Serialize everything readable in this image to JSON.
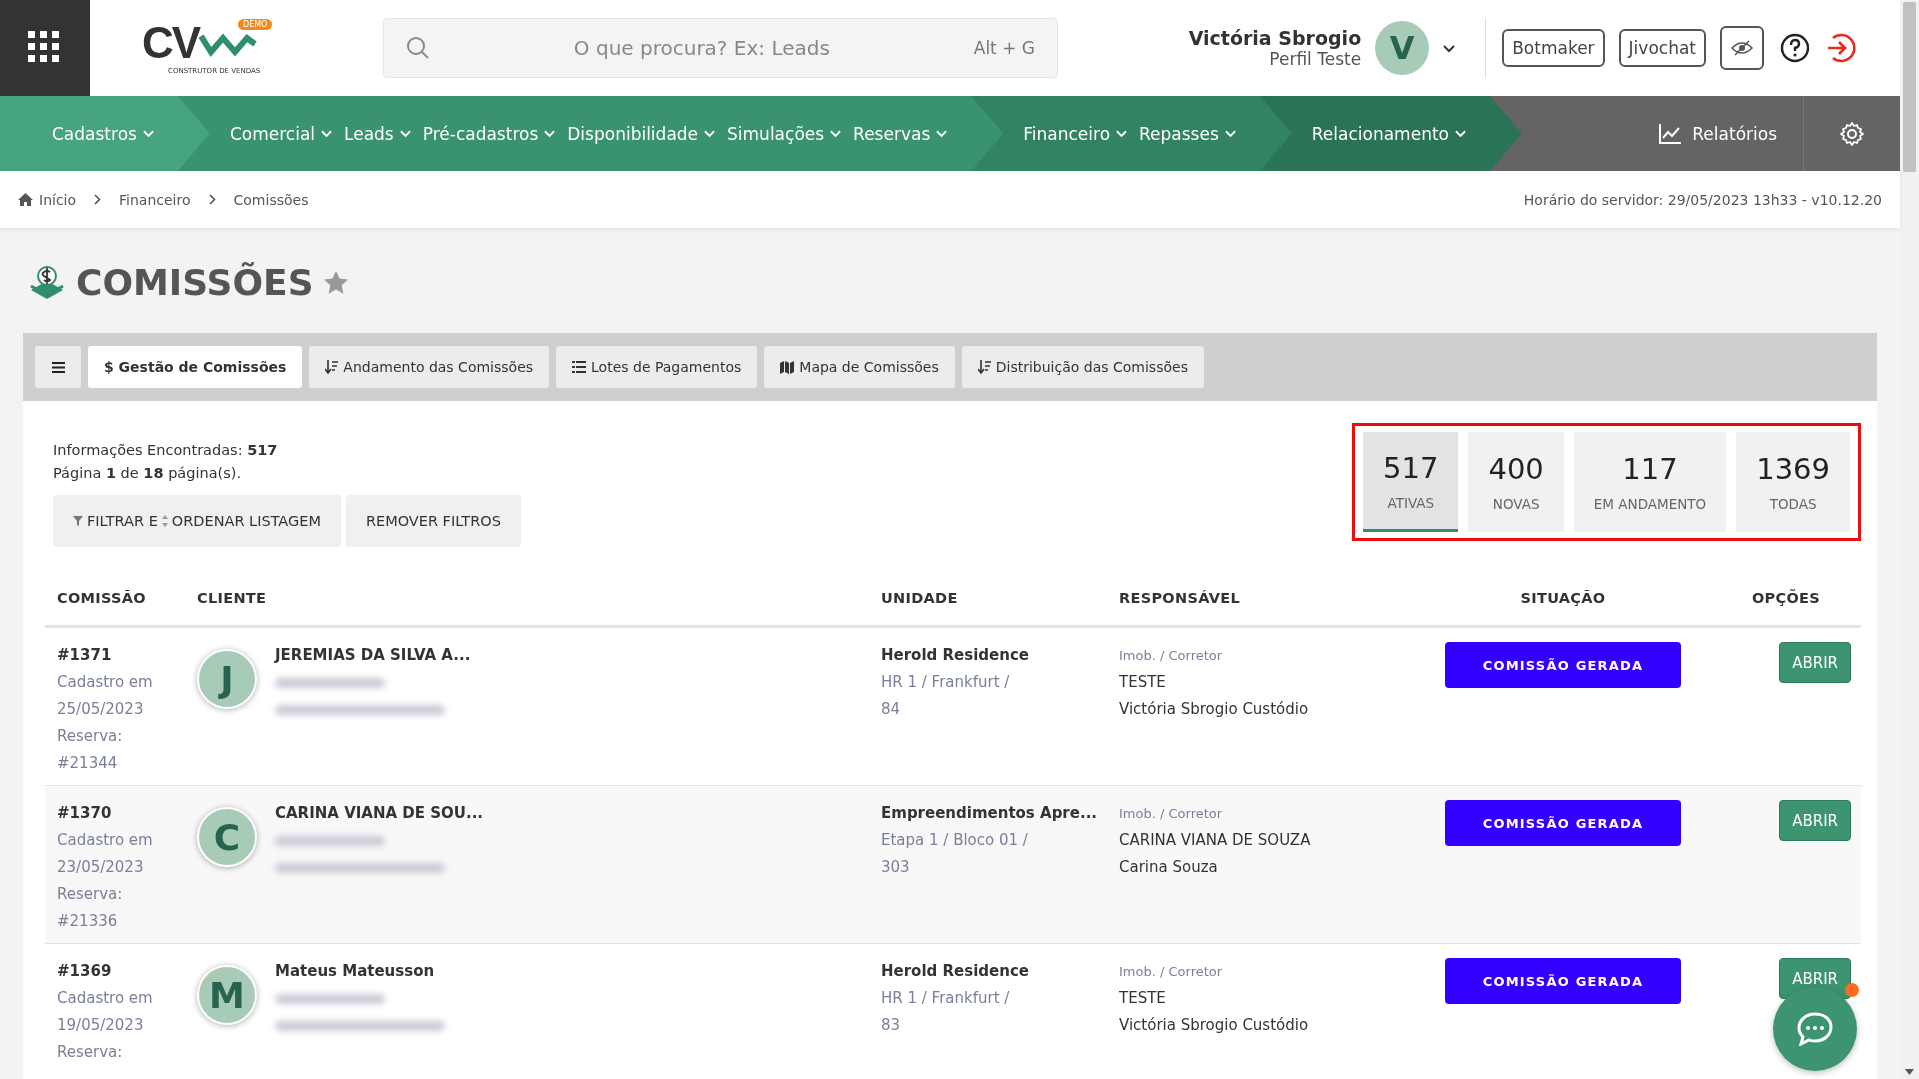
{
  "header": {
    "logo": {
      "text": "CV",
      "badge": "DEMO",
      "tagline": "CONSTRUTOR DE VENDAS"
    },
    "search": {
      "placeholder": "O que procura? Ex: Leads",
      "shortcut": "Alt + G"
    },
    "user": {
      "name": "Victória Sbrogio",
      "profile": "Perfil Teste",
      "initial": "V"
    },
    "buttons": [
      "Botmaker",
      "Jivochat"
    ]
  },
  "nav": {
    "groups": [
      {
        "items": [
          "Cadastros"
        ]
      },
      {
        "items": [
          "Comercial",
          "Leads",
          "Pré-cadastros",
          "Disponibilidade",
          "Simulações",
          "Reservas"
        ]
      },
      {
        "items": [
          "Financeiro",
          "Repasses"
        ]
      },
      {
        "items": [
          "Relacionamento"
        ]
      }
    ],
    "reports": "Relatórios"
  },
  "breadcrumb": {
    "items": [
      "Início",
      "Financeiro",
      "Comissões"
    ],
    "server_time": "Horário do servidor: 29/05/2023 13h33 - v10.12.20"
  },
  "page_title": "COMISSÕES",
  "tabs": [
    {
      "label": "$ Gestão de Comissões",
      "kind": "plain",
      "selected": true
    },
    {
      "label": "Andamento das Comissões",
      "kind": "sort",
      "selected": false
    },
    {
      "label": "Lotes de Pagamentos",
      "kind": "list",
      "selected": false
    },
    {
      "label": "Mapa de Comissões",
      "kind": "map",
      "selected": false
    },
    {
      "label": "Distribuição das Comissões",
      "kind": "sort",
      "selected": false
    }
  ],
  "summary": {
    "found": "Informações Encontradas: **517**",
    "page": "Página **1** de **18** página(s)."
  },
  "filter_button": {
    "label_start": "FILTRAR E",
    "label_end": "ORDENAR LISTAGEM"
  },
  "clear_button": "REMOVER FILTROS",
  "stats": [
    {
      "value": "517",
      "label": "ATIVAS",
      "selected": true
    },
    {
      "value": "400",
      "label": "NOVAS",
      "selected": false
    },
    {
      "value": "117",
      "label": "EM ANDAMENTO",
      "selected": false
    },
    {
      "value": "1369",
      "label": "TODAS",
      "selected": false
    }
  ],
  "table": {
    "columns": [
      "COMISSÃO",
      "CLIENTE",
      "UNIDADE",
      "RESPONSÁVEL",
      "SITUAÇÃO",
      "OPÇÕES"
    ],
    "rows": [
      {
        "id": "#1371",
        "registered_label": "Cadastro em",
        "registered_date": "25/05/2023",
        "reservation_label": "Reserva:",
        "reservation": "#21344",
        "initial": "J",
        "client": "JEREMIAS DA SILVA A...",
        "unit": "Herold Residence",
        "unit_lines": [
          "HR 1 / Frankfurt /",
          "84"
        ],
        "role": "Imob. / Corretor",
        "agency": "TESTE",
        "agent": "Victória Sbrogio Custódio",
        "status": "COMISSÃO GERADA",
        "action": "ABRIR"
      },
      {
        "id": "#1370",
        "registered_label": "Cadastro em",
        "registered_date": "23/05/2023",
        "reservation_label": "Reserva:",
        "reservation": "#21336",
        "initial": "C",
        "client": "CARINA VIANA DE SOU...",
        "unit": "Empreendimentos Apre...",
        "unit_lines": [
          "Etapa 1 / Bloco 01 /",
          "303"
        ],
        "role": "Imob. / Corretor",
        "agency": "CARINA VIANA DE SOUZA",
        "agent": "Carina Souza",
        "status": "COMISSÃO GERADA",
        "action": "ABRIR"
      },
      {
        "id": "#1369",
        "registered_label": "Cadastro em",
        "registered_date": "19/05/2023",
        "reservation_label": "Reserva:",
        "initial": "M",
        "client": "Mateus Mateusson",
        "unit": "Herold Residence",
        "unit_lines": [
          "HR 1 / Frankfurt /",
          "83"
        ],
        "role": "Imob. / Corretor",
        "agency": "TESTE",
        "agent": "Victória Sbrogio Custódio",
        "status": "COMISSÃO GERADA",
        "action": "ABRIR"
      }
    ]
  }
}
